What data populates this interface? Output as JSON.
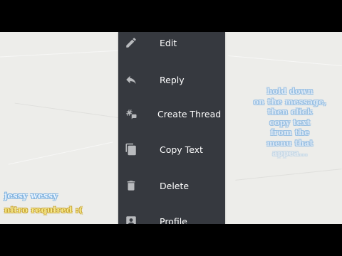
{
  "menu": {
    "items": [
      {
        "label": "Edit",
        "icon": "pencil-icon"
      },
      {
        "label": "Reply",
        "icon": "reply-icon"
      },
      {
        "label": "Create Thread",
        "icon": "thread-icon"
      },
      {
        "label": "Copy Text",
        "icon": "copy-icon"
      },
      {
        "label": "Delete",
        "icon": "trash-icon"
      },
      {
        "label": "Profile",
        "icon": "profile-icon"
      }
    ],
    "background": "#36393f",
    "icon_color": "#b9bbbe",
    "text_color": "#ffffff"
  },
  "instruction": {
    "lines": [
      "hold down",
      "on the message,",
      "then click",
      "copy text",
      "from the",
      "menu that"
    ],
    "last_line": "appea..."
  },
  "credits": {
    "line1": "jessy wessy",
    "line2": "nitro required :("
  },
  "colors": {
    "paper": "#ededea",
    "letterbox": "#000000"
  }
}
